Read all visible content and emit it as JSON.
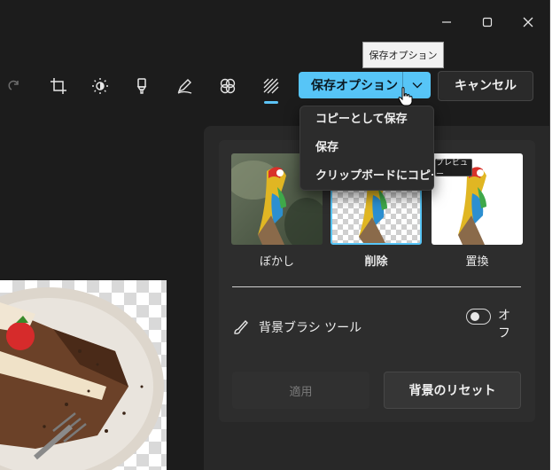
{
  "window": {
    "tooltip": "保存オプション"
  },
  "toolbar": {
    "save_label": "保存オプション",
    "cancel_label": "キャンセル",
    "active_tool": "background-removal"
  },
  "save_menu": {
    "items": [
      {
        "label": "コピーとして保存"
      },
      {
        "label": "保存"
      },
      {
        "label": "クリップボードにコピー"
      }
    ]
  },
  "background_panel": {
    "options": [
      {
        "label": "ぼかし",
        "selected": false
      },
      {
        "label": "削除",
        "selected": true
      },
      {
        "label": "置換",
        "selected": false
      }
    ],
    "preview_tooltip": "プレビュー",
    "brush_tool_label": "背景ブラシ ツール",
    "toggle_label": "オフ",
    "toggle_on": false,
    "apply_label": "適用",
    "reset_label": "背景のリセット"
  },
  "colors": {
    "accent": "#57c5f7",
    "window_bg": "#1c1c1c",
    "panel_bg": "#282828"
  }
}
